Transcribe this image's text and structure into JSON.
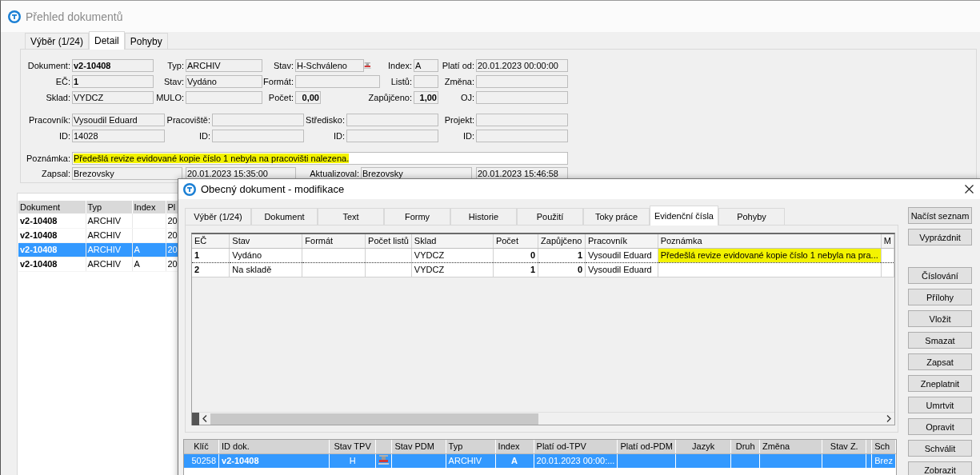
{
  "main_window": {
    "title": "Přehled dokumentů",
    "tabs": [
      {
        "label": "Výběr (1/24)",
        "selected": false
      },
      {
        "label": "Detail",
        "selected": true
      },
      {
        "label": "Pohyby",
        "selected": false
      }
    ],
    "form": {
      "groups": [
        {
          "rows": [
            {
              "fields": [
                {
                  "label": "Dokument:",
                  "value": "v2-10408",
                  "bold": true,
                  "kind": "text"
                },
                {
                  "label": "Typ:",
                  "value": "ARCHIV",
                  "bold": false,
                  "kind": "text"
                },
                {
                  "label": "Stav:",
                  "value": "H-Schváleno",
                  "bold": false,
                  "kind": "text"
                },
                {
                  "label": "Index:",
                  "value": "A",
                  "bold": false,
                  "kind": "text"
                },
                {
                  "label": "Platí od:",
                  "value": "20.01.2023 00:00:00",
                  "bold": false,
                  "kind": "text"
                }
              ]
            },
            {
              "fields": [
                {
                  "label": "EČ:",
                  "value": "1",
                  "bold": true,
                  "kind": "text"
                },
                {
                  "label": "Stav:",
                  "value": "Vydáno",
                  "bold": false,
                  "kind": "text"
                },
                {
                  "label": "Formát:"
                },
                {
                  "label": "Listů:"
                },
                {
                  "label": "Změna:"
                }
              ]
            },
            {
              "fields": [
                {
                  "label": "Sklad:",
                  "value": "VYDCZ",
                  "bold": false,
                  "kind": "text"
                },
                {
                  "label": "MULO:"
                },
                {
                  "label": "Počet:",
                  "value": "0,00",
                  "bold": true,
                  "kind": "number"
                },
                {
                  "label": "Zapůjčeno:",
                  "value": "1,00",
                  "bold": true,
                  "kind": "number"
                },
                {
                  "label": "OJ:"
                }
              ]
            }
          ]
        },
        {
          "rows": [
            {
              "fields": [
                {
                  "label": "Pracovník:",
                  "value": "Vysoudil Eduard",
                  "bold": false,
                  "kind": "text"
                },
                {
                  "label": "Pracoviště:"
                },
                {
                  "label": "Středisko:"
                },
                {
                  "label": "Projekt:"
                }
              ]
            },
            {
              "fields": [
                {
                  "label": "ID:",
                  "value": "14028",
                  "bold": false,
                  "kind": "text"
                },
                {
                  "label": "ID:"
                },
                {
                  "label": "ID:"
                },
                {
                  "label": "ID:"
                }
              ]
            }
          ]
        }
      ],
      "note": {
        "label": "Poznámka:",
        "value": "Předešlá revize evidované kopie číslo 1 nebyla na pracovišti nalezena.",
        "highlighted": true
      },
      "audit": {
        "fields": [
          {
            "label": "Zapsal:",
            "value": "Brezovsky",
            "bold": false,
            "kind": "text"
          },
          {
            "value": "20.01.2023 15:35:00",
            "bold": false,
            "kind": "text"
          },
          {
            "label": "Aktualizoval:",
            "value": "Brezovsky",
            "bold": false,
            "kind": "text"
          },
          {
            "value": "20.01.2023 15:46:58",
            "bold": false,
            "kind": "text"
          }
        ]
      }
    },
    "list": {
      "columns": [
        "Dokument",
        "Typ",
        "Index",
        "Pl"
      ],
      "rows": [
        {
          "cells": [
            "v2-10408",
            "ARCHIV",
            null,
            "20"
          ],
          "selected": false
        },
        {
          "cells": [
            "v2-10408",
            "ARCHIV",
            null,
            "20"
          ],
          "selected": false
        },
        {
          "cells": [
            "v2-10408",
            "ARCHIV",
            "A",
            "20"
          ],
          "selected": true
        },
        {
          "cells": [
            "v2-10408",
            "ARCHIV",
            "A",
            "20"
          ],
          "selected": false
        }
      ]
    }
  },
  "dialog": {
    "title": "Obecný dokument - modifikace",
    "tabs": [
      {
        "label": "Výběr (1/24)",
        "selected": false
      },
      {
        "label": "Dokument",
        "selected": false
      },
      {
        "label": "Text",
        "selected": false
      },
      {
        "label": "Formy",
        "selected": false
      },
      {
        "label": "Historie",
        "selected": false
      },
      {
        "label": "Použití",
        "selected": false
      },
      {
        "label": "Toky práce",
        "selected": false
      },
      {
        "label": "Evidenční čísla",
        "selected": true
      },
      {
        "label": "Pohyby",
        "selected": false
      }
    ],
    "grid": {
      "columns": [
        {
          "label": "EČ",
          "kind": "key"
        },
        {
          "label": "Stav",
          "kind": "text"
        },
        {
          "label": "Formát",
          "kind": "text"
        },
        {
          "label": "Počet listů",
          "kind": "text"
        },
        {
          "label": "Sklad",
          "kind": "text"
        },
        {
          "label": "Počet",
          "kind": "count"
        },
        {
          "label": "Zapůjčeno",
          "kind": "count"
        },
        {
          "label": "Pracovník",
          "kind": "text"
        },
        {
          "label": "Poznámka",
          "kind": "text"
        },
        {
          "label": "M",
          "kind": "text"
        }
      ],
      "rows": [
        {
          "cells": [
            "1",
            "Vydáno",
            null,
            null,
            "VYDCZ",
            "0",
            "1",
            "Vysoudil Eduard",
            "Předešlá revize evidované kopie číslo 1 nebyla na pra...",
            null
          ],
          "focused": true,
          "note_highlighted": true
        },
        {
          "cells": [
            "2",
            "Na skladě",
            null,
            null,
            "VYDCZ",
            "1",
            "0",
            "Vysoudil Eduard",
            null,
            null
          ],
          "focused": false,
          "note_highlighted": false
        }
      ]
    },
    "buttons_top": [
      "Načíst seznam",
      "Vyprázdnit"
    ],
    "buttons": [
      "Číslování",
      "Přílohy",
      "Vložit",
      "Smazat",
      "Zapsat",
      "Zneplatnit",
      "Umrtvit",
      "Opravit",
      "Schválit",
      "Zobrazit"
    ],
    "bottom_grid": {
      "columns": [
        {
          "label": "Klíč",
          "kind": "number"
        },
        {
          "label": "ID dok.",
          "kind": "key"
        },
        {
          "label": "Stav TPV",
          "kind": "code"
        },
        {
          "kind": "icon"
        },
        {
          "label": "Stav PDM",
          "kind": "text"
        },
        {
          "label": "Typ",
          "kind": "text"
        },
        {
          "label": "Index",
          "kind": "mark"
        },
        {
          "label": "Platí od-TPV",
          "kind": "text"
        },
        {
          "label": "Platí od-PDM",
          "kind": "text"
        },
        {
          "label": "Jazyk",
          "kind": "code"
        },
        {
          "label": "Druh",
          "kind": "code"
        },
        {
          "label": "Změna",
          "kind": "text"
        },
        {
          "label": "Stav Z.",
          "kind": "code"
        },
        {
          "kind": "text"
        },
        {
          "label": "Sch",
          "kind": "text"
        }
      ],
      "rows": [
        {
          "cells": [
            "50258",
            "v2-10408",
            "H",
            null,
            null,
            "ARCHIV",
            "A",
            "20.01.2023 00:00:...",
            null,
            null,
            null,
            null,
            null,
            null,
            "Brez"
          ],
          "selected": true
        }
      ]
    }
  }
}
